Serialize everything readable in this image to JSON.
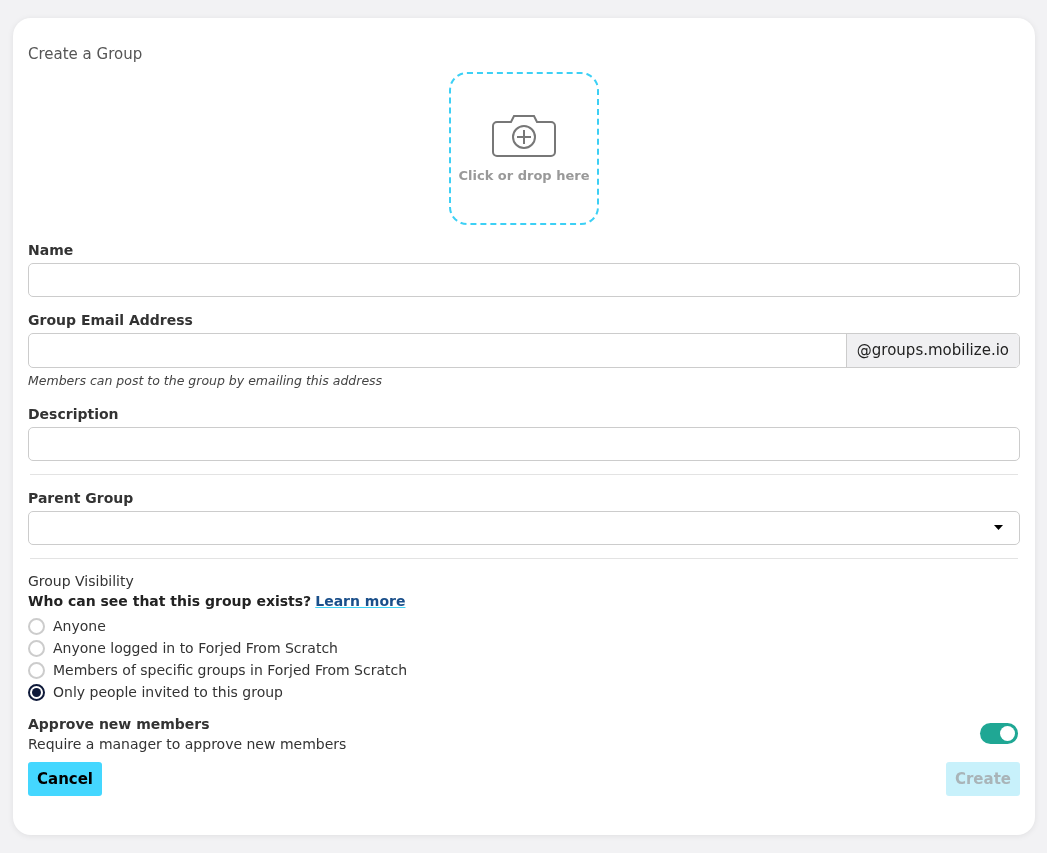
{
  "title": "Create a Group",
  "dropzone": {
    "label": "Click or drop here"
  },
  "name_field": {
    "label": "Name"
  },
  "email_field": {
    "label": "Group Email Address",
    "suffix": "@groups.mobilize.io",
    "hint": "Members can post to the group by emailing this address"
  },
  "description_field": {
    "label": "Description"
  },
  "parent_group": {
    "label": "Parent Group"
  },
  "visibility": {
    "heading": "Group Visibility",
    "question": "Who can see that this group exists?",
    "link": "Learn more",
    "options": [
      {
        "label": "Anyone",
        "selected": false
      },
      {
        "label": "Anyone logged in to Forjed From Scratch",
        "selected": false
      },
      {
        "label": "Members of specific groups in Forjed From Scratch",
        "selected": false
      },
      {
        "label": "Only people invited to this group",
        "selected": true
      }
    ]
  },
  "approve": {
    "title": "Approve new members",
    "description": "Require a manager to approve new members",
    "on": true
  },
  "buttons": [
    {
      "label": "Cancel",
      "disabled": false,
      "kind": "secondary"
    },
    {
      "label": "Create",
      "disabled": true,
      "kind": "primary"
    }
  ]
}
